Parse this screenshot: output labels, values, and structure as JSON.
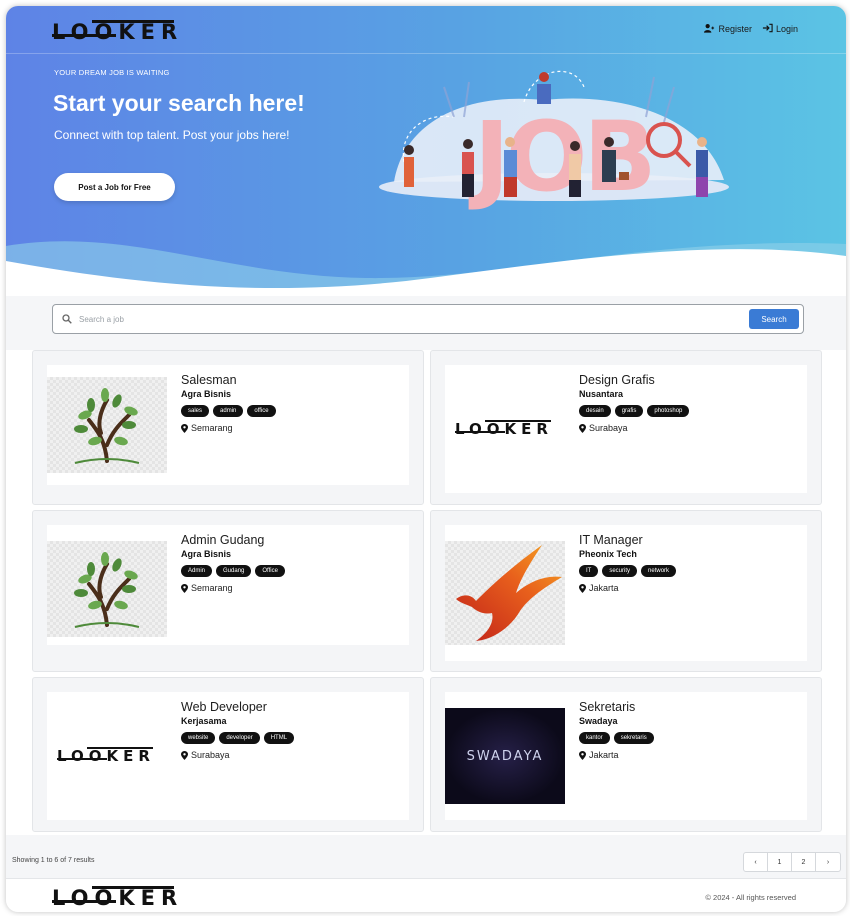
{
  "brand": {
    "name": "LOOKER"
  },
  "nav": {
    "register": "Register",
    "login": "Login"
  },
  "hero": {
    "eyebrow": "YOUR DREAM JOB IS WAITING",
    "title": "Start your search here!",
    "subtitle": "Connect with top talent. Post your jobs here!",
    "cta": "Post a Job for Free",
    "illustration_text": "JOB"
  },
  "search": {
    "placeholder": "Search a job",
    "button": "Search"
  },
  "jobs": [
    {
      "title": "Salesman",
      "company": "Agra Bisnis",
      "tags": [
        "sales",
        "admin",
        "office"
      ],
      "location": "Semarang",
      "logo": "tree-logo"
    },
    {
      "title": "Design Grafis",
      "company": "Nusantara",
      "tags": [
        "desain",
        "grafis",
        "photoshop"
      ],
      "location": "Surabaya",
      "logo": "looker-logo"
    },
    {
      "title": "Admin Gudang",
      "company": "Agra Bisnis",
      "tags": [
        "Admin",
        "Gudang",
        "Office"
      ],
      "location": "Semarang",
      "logo": "tree-logo"
    },
    {
      "title": "IT Manager",
      "company": "Pheonix Tech",
      "tags": [
        "IT",
        "security",
        "network"
      ],
      "location": "Jakarta",
      "logo": "phoenix-logo"
    },
    {
      "title": "Web Developer",
      "company": "Kerjasama",
      "tags": [
        "website",
        "developer",
        "HTML"
      ],
      "location": "Surabaya",
      "logo": "looker-logo"
    },
    {
      "title": "Sekretaris",
      "company": "Swadaya",
      "tags": [
        "kantor",
        "sekretaris"
      ],
      "location": "Jakarta",
      "logo": "swadaya-logo",
      "logo_text": "SWADAYA"
    }
  ],
  "pagination": {
    "summary": "Showing 1 to 6 of 7 results",
    "prev": "‹",
    "pages": [
      "1",
      "2"
    ],
    "next": "›"
  },
  "footer": {
    "copyright": "© 2024 - All rights reserved"
  },
  "colors": {
    "hero_start": "#5e83e6",
    "hero_end": "#5bc4e4",
    "search_button": "#3a7bd5",
    "tag_bg": "#111111"
  }
}
